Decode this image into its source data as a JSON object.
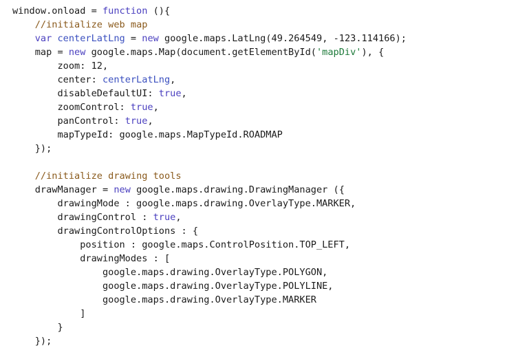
{
  "code_lines": [
    [
      {
        "t": "window.onload = ",
        "k": "plain"
      },
      {
        "t": "function",
        "k": "keyword"
      },
      {
        "t": " (){",
        "k": "plain"
      }
    ],
    [
      {
        "t": "    ",
        "k": "plain"
      },
      {
        "t": "//initialize web map",
        "k": "comment"
      }
    ],
    [
      {
        "t": "    ",
        "k": "plain"
      },
      {
        "t": "var",
        "k": "keyword"
      },
      {
        "t": " ",
        "k": "plain"
      },
      {
        "t": "centerLatLng",
        "k": "variable"
      },
      {
        "t": " = ",
        "k": "plain"
      },
      {
        "t": "new",
        "k": "keyword"
      },
      {
        "t": " google.maps.LatLng(",
        "k": "plain"
      },
      {
        "t": "49.264549",
        "k": "number"
      },
      {
        "t": ", -",
        "k": "plain"
      },
      {
        "t": "123.114166",
        "k": "number"
      },
      {
        "t": ");",
        "k": "plain"
      }
    ],
    [
      {
        "t": "    map = ",
        "k": "plain"
      },
      {
        "t": "new",
        "k": "keyword"
      },
      {
        "t": " google.maps.Map(document.getElementById(",
        "k": "plain"
      },
      {
        "t": "'mapDiv'",
        "k": "string-hl"
      },
      {
        "t": "), {",
        "k": "plain"
      }
    ],
    [
      {
        "t": "        zoom: ",
        "k": "plain"
      },
      {
        "t": "12",
        "k": "number"
      },
      {
        "t": ",",
        "k": "plain"
      }
    ],
    [
      {
        "t": "        center: ",
        "k": "plain"
      },
      {
        "t": "centerLatLng",
        "k": "variable"
      },
      {
        "t": ",",
        "k": "plain"
      }
    ],
    [
      {
        "t": "        disableDefaultUI: ",
        "k": "plain"
      },
      {
        "t": "true",
        "k": "keyword"
      },
      {
        "t": ",",
        "k": "plain"
      }
    ],
    [
      {
        "t": "        zoomControl: ",
        "k": "plain"
      },
      {
        "t": "true",
        "k": "keyword"
      },
      {
        "t": ",",
        "k": "plain"
      }
    ],
    [
      {
        "t": "        panControl: ",
        "k": "plain"
      },
      {
        "t": "true",
        "k": "keyword"
      },
      {
        "t": ",",
        "k": "plain"
      }
    ],
    [
      {
        "t": "        mapTypeId: google.maps.MapTypeId.ROADMAP",
        "k": "plain"
      }
    ],
    [
      {
        "t": "    });",
        "k": "plain"
      }
    ],
    [],
    [
      {
        "t": "    ",
        "k": "plain"
      },
      {
        "t": "//initialize drawing tools",
        "k": "comment"
      }
    ],
    [
      {
        "t": "    drawManager = ",
        "k": "plain"
      },
      {
        "t": "new",
        "k": "keyword"
      },
      {
        "t": " google.maps.drawing.DrawingManager ({",
        "k": "plain"
      }
    ],
    [
      {
        "t": "        drawingMode : google.maps.drawing.OverlayType.MARKER,",
        "k": "plain"
      }
    ],
    [
      {
        "t": "        drawingControl : ",
        "k": "plain"
      },
      {
        "t": "true",
        "k": "keyword"
      },
      {
        "t": ",",
        "k": "plain"
      }
    ],
    [
      {
        "t": "        drawingControlOptions : {",
        "k": "plain"
      }
    ],
    [
      {
        "t": "            position : google.maps.ControlPosition.TOP_LEFT,",
        "k": "plain"
      }
    ],
    [
      {
        "t": "            drawingModes : [",
        "k": "plain"
      }
    ],
    [
      {
        "t": "                google.maps.drawing.OverlayType.POLYGON,",
        "k": "plain"
      }
    ],
    [
      {
        "t": "                google.maps.drawing.OverlayType.POLYLINE,",
        "k": "plain"
      }
    ],
    [
      {
        "t": "                google.maps.drawing.OverlayType.MARKER",
        "k": "plain"
      }
    ],
    [
      {
        "t": "            ]",
        "k": "plain"
      }
    ],
    [
      {
        "t": "        }",
        "k": "plain"
      }
    ],
    [
      {
        "t": "    });",
        "k": "plain"
      }
    ]
  ],
  "colors": {
    "background": "#ffffff",
    "plain": "#1a1a1a",
    "keyword": "#4a3fbf",
    "comment": "#8a5a1c",
    "variable": "#3a4fbf",
    "string_highlight": "#1e7a3a"
  }
}
